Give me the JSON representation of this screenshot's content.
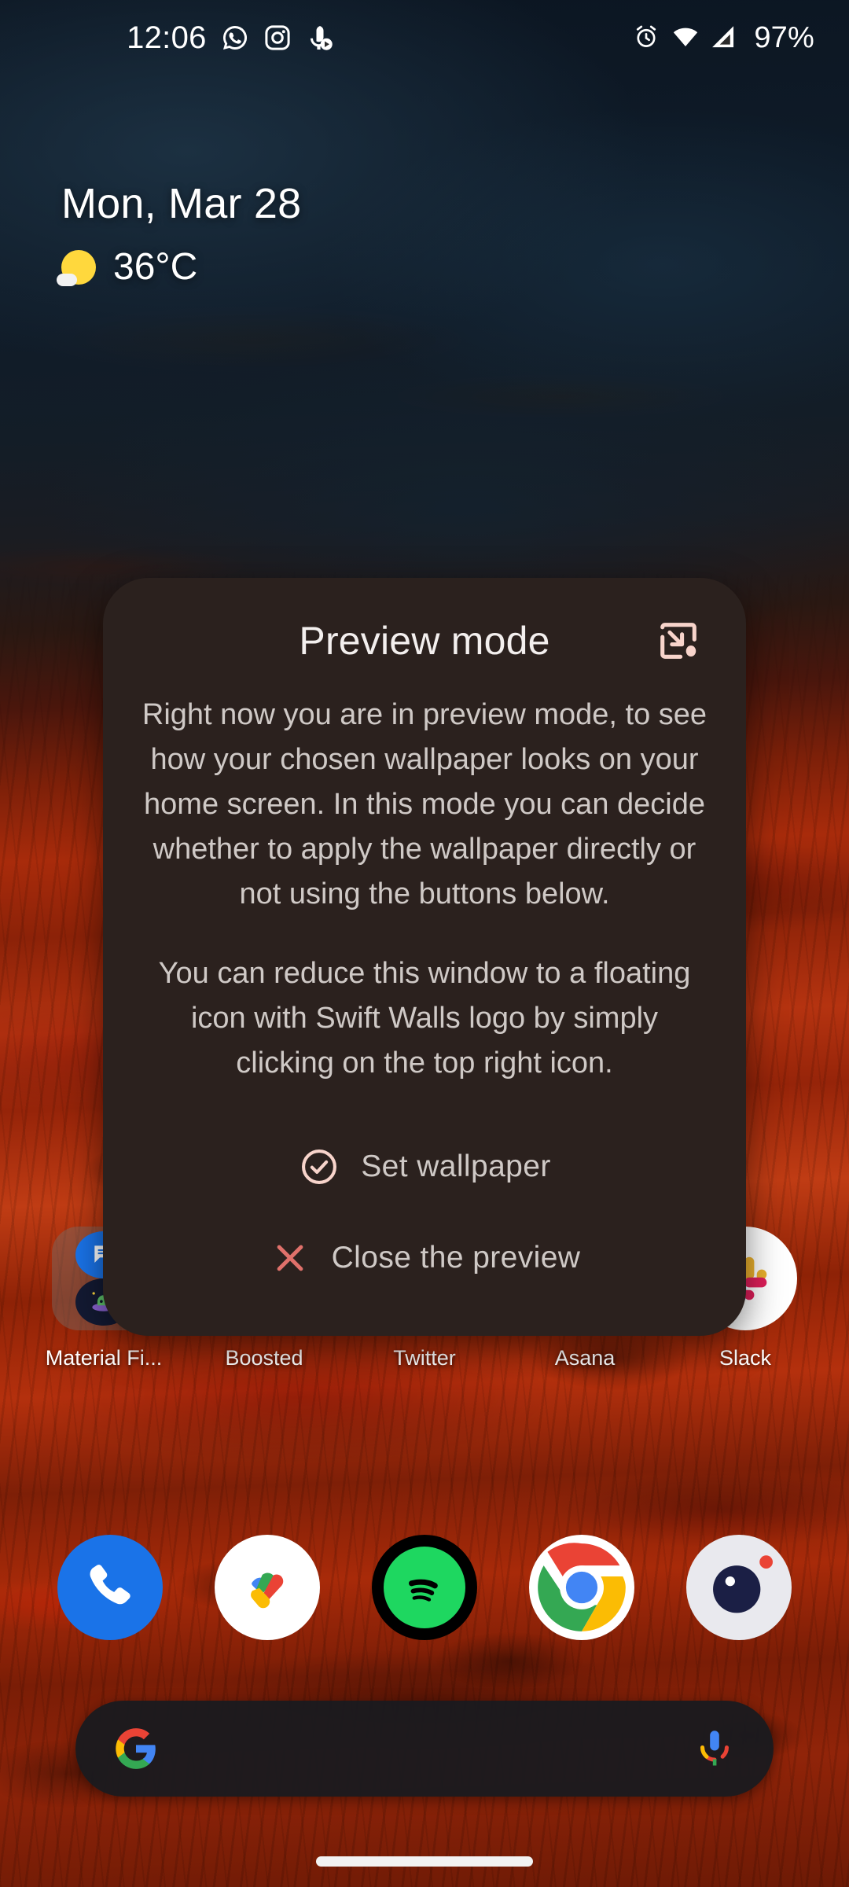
{
  "status_bar": {
    "time": "12:06",
    "battery": "97%",
    "notification_icons": [
      "whatsapp-icon",
      "instagram-icon",
      "podcast-icon"
    ],
    "system_icons": [
      "alarm-icon",
      "wifi-icon",
      "cellular-signal-icon"
    ]
  },
  "widget": {
    "date": "Mon, Mar 28",
    "temperature": "36°C",
    "weather_icon": "sun-icon"
  },
  "app_row": [
    {
      "label": "Material Fi...",
      "icon": "folder-icon"
    },
    {
      "label": "Boosted",
      "icon": "boosted-icon"
    },
    {
      "label": "Twitter",
      "icon": "twitter-icon"
    },
    {
      "label": "Asana",
      "icon": "asana-icon"
    },
    {
      "label": "Slack",
      "icon": "slack-icon"
    }
  ],
  "dock": [
    {
      "name": "Phone",
      "icon": "phone-icon"
    },
    {
      "name": "Google Pay",
      "icon": "google-pay-icon"
    },
    {
      "name": "Spotify",
      "icon": "spotify-icon"
    },
    {
      "name": "Chrome",
      "icon": "chrome-icon"
    },
    {
      "name": "Camera",
      "icon": "camera-icon"
    }
  ],
  "search": {
    "value": "",
    "placeholder": "",
    "logo_icon": "google-g-icon",
    "mic_icon": "microphone-icon"
  },
  "dialog": {
    "title": "Preview mode",
    "minimize_icon": "picture-in-picture-icon",
    "paragraph_1": "Right now you are in preview mode, to see how your chosen wallpaper looks on your home screen. In this mode you can decide whether to apply the wallpaper directly or not using the buttons below.",
    "paragraph_2": "You can reduce this window to a floating icon with Swift Walls logo by simply clicking on the top right icon.",
    "set_wallpaper_label": "Set wallpaper",
    "set_wallpaper_icon": "check-circle-icon",
    "close_preview_label": "Close the preview",
    "close_preview_icon": "close-x-icon"
  },
  "colors": {
    "dialog_background": "#2b211e",
    "accent_pink": "#f8d4cb",
    "accent_red": "#e0716b",
    "body_text": "#cfc9c6",
    "title_text": "#f3efee",
    "search_background": "#1a1a1e"
  }
}
